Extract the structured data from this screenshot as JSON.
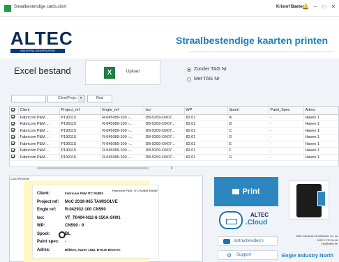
{
  "window": {
    "title": "Straalbestendige cards.xlsm",
    "user": "Kristof Baetens"
  },
  "brand": {
    "logo": "ALTEC",
    "logo_sub": "INDUSTRIAL IDENTIFICATION",
    "app_title": "Straalbestendige kaarten printen"
  },
  "excel": {
    "label": "Excel bestand",
    "upload": "Upload",
    "icon": "excel-icon"
  },
  "options": {
    "zonder": "Zonder TAG Nr",
    "met": "Met TAG Nr",
    "selected": "zonder"
  },
  "filter": {
    "select_value": "Client/Proje...",
    "find": "Find"
  },
  "table": {
    "columns": [
      "",
      "Client",
      "Project_ref",
      "Engie_ref",
      "Iso",
      "WP",
      "Spool",
      "Paint_Spec",
      "Adres"
    ],
    "rows": [
      [
        "Fabricom P&M ...",
        "P190115",
        "R-045089-100 -...",
        "DB-5209-OX07...",
        "82.01",
        "A",
        "-",
        "Haven 1"
      ],
      [
        "Fabricom P&M ...",
        "P190115",
        "R-045089-100 -...",
        "DB-5209-OX07...",
        "82.01",
        "B",
        "-",
        "Haven 1"
      ],
      [
        "Fabricom P&M ...",
        "P190115",
        "R-045089-100 -...",
        "DB-5209-OX07...",
        "82.01",
        "C",
        "-",
        "Haven 1"
      ],
      [
        "Fabricom P&M ...",
        "P190115",
        "R-045089-100 -...",
        "DB-5209-OX07...",
        "82.01",
        "D",
        "-",
        "Haven 1"
      ],
      [
        "Fabricom P&M ...",
        "P190115",
        "R-045089-100 -...",
        "DB-5209-OX07...",
        "82.01",
        "E",
        "-",
        "Haven 1"
      ],
      [
        "Fabricom P&M ...",
        "P190115",
        "R-045089-100 -...",
        "DB-5209-OX07...",
        "82.01",
        "F",
        "-",
        "Haven 1"
      ],
      [
        "Fabricom P&M ...",
        "P190115",
        "R-045089-100 -...",
        "DB-5209-OX07...",
        "82.01",
        "G",
        "-",
        "Haven 1"
      ]
    ]
  },
  "preview": {
    "label": "Card Preview",
    "card_logo": "Fabricom P&M / ITC RUBIS  ENGIE",
    "fields": [
      {
        "k": "Client:",
        "v": "Fabricom P&M ITC RUBIS"
      },
      {
        "k": "Project ref:",
        "v": "MoC 2019-065 TAMISOLVE"
      },
      {
        "k": "Engie ref:",
        "v": "R-042932-100 CN590"
      },
      {
        "k": "Iso:",
        "v": "VT_T0404-N12-6-150A-SH01"
      },
      {
        "k": "WP:",
        "v": "CN590 - 9"
      },
      {
        "k": "Spool:",
        "v": "BL"
      },
      {
        "k": "Paint spec:",
        "v": "-"
      },
      {
        "k": "Adres:",
        "v": "Blikken, Haven 1662, B-9130 Beveren"
      }
    ]
  },
  "actions": {
    "print": "Print",
    "instructions": "Instructievideo's",
    "support": "Support"
  },
  "cloud": {
    "line1": "ALTEC",
    "line2": ".Cloud"
  },
  "contact": {
    "line1": "Altec Industrial Identification nv / sa",
    "line2": "0032 2 270 34 66",
    "line3": "info@altec.be"
  },
  "footer": {
    "engie": "Engie Industry North"
  },
  "colors": {
    "accent": "#1a7fc2",
    "print_button": "#2e86c1",
    "navy": "#0b2a55",
    "excel": "#1e7e45"
  }
}
